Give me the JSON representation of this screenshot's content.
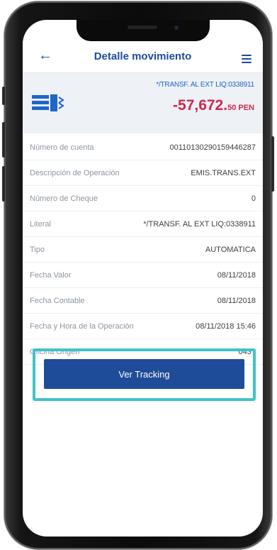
{
  "header": {
    "title": "Detalle movimiento",
    "back_icon": "arrow-left-icon",
    "menu_icon": "hamburger-icon"
  },
  "summary": {
    "reference": "*/TRANSF. AL EXT LIQ:0338911",
    "amount_int": "-57,672.",
    "amount_dec": "50 PEN",
    "icon": "transfer-icon",
    "amount_color": "#d0284a"
  },
  "details": [
    {
      "label": "Número de cuenta",
      "value": "00110130290159446287"
    },
    {
      "label": "Descripción de Operación",
      "value": "EMIS.TRANS.EXT"
    },
    {
      "label": "Número de Cheque",
      "value": "0"
    },
    {
      "label": "Literal",
      "value": "*/TRANSF. AL EXT LIQ:0338911"
    },
    {
      "label": "Tipo",
      "value": "AUTOMATICA"
    },
    {
      "label": "Fecha Valor",
      "value": "08/11/2018"
    },
    {
      "label": "Fecha Contable",
      "value": "08/11/2018"
    },
    {
      "label": "Fecha y Hora de la Operación",
      "value": "08/11/2018 15:46"
    },
    {
      "label": "Oficina Origen",
      "value": "0437"
    }
  ],
  "actions": {
    "tracking_label": "Ver Tracking",
    "button_color": "#1f4c99",
    "highlight_color": "#3ec4c6"
  }
}
